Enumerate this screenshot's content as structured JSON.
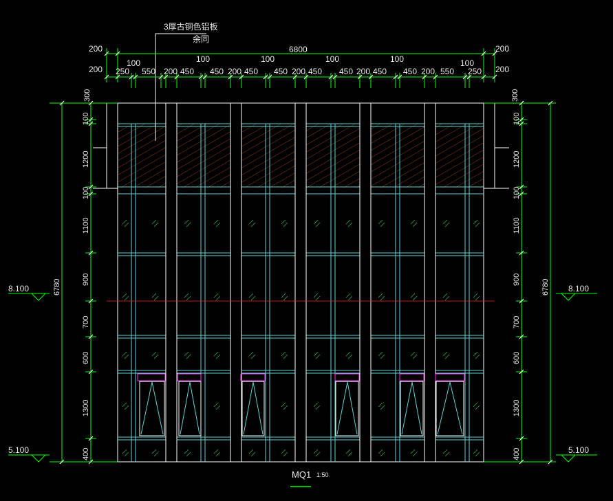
{
  "annotation": {
    "line1": "3厚古铜色铝板",
    "line2": "余同"
  },
  "top_dims": {
    "overall": "6800",
    "side_left_upper": "200",
    "side_right_upper": "200",
    "side_left_lower": "200",
    "side_right_lower": "200",
    "hundreds": [
      "100",
      "100",
      "100",
      "100",
      "100"
    ],
    "segments": [
      "250",
      "550",
      "200",
      "450",
      "450",
      "200",
      "450",
      "450",
      "200",
      "450",
      "450",
      "200",
      "450",
      "450",
      "200",
      "550",
      "250"
    ]
  },
  "left_dims": {
    "top": "300",
    "segments": [
      "100",
      "1200",
      "100",
      "1100",
      "900",
      "700",
      "600",
      "1300",
      "400"
    ],
    "overall": "6780",
    "level_upper": "8.100",
    "level_lower": "5.100"
  },
  "right_dims": {
    "top": "300",
    "segments": [
      "100",
      "1200",
      "100",
      "1100",
      "900",
      "700",
      "600",
      "1300",
      "400"
    ],
    "overall": "6780",
    "level_upper": "8.100",
    "level_lower": "5.100"
  },
  "title": {
    "name": "MQ1",
    "scale": "1:50"
  }
}
